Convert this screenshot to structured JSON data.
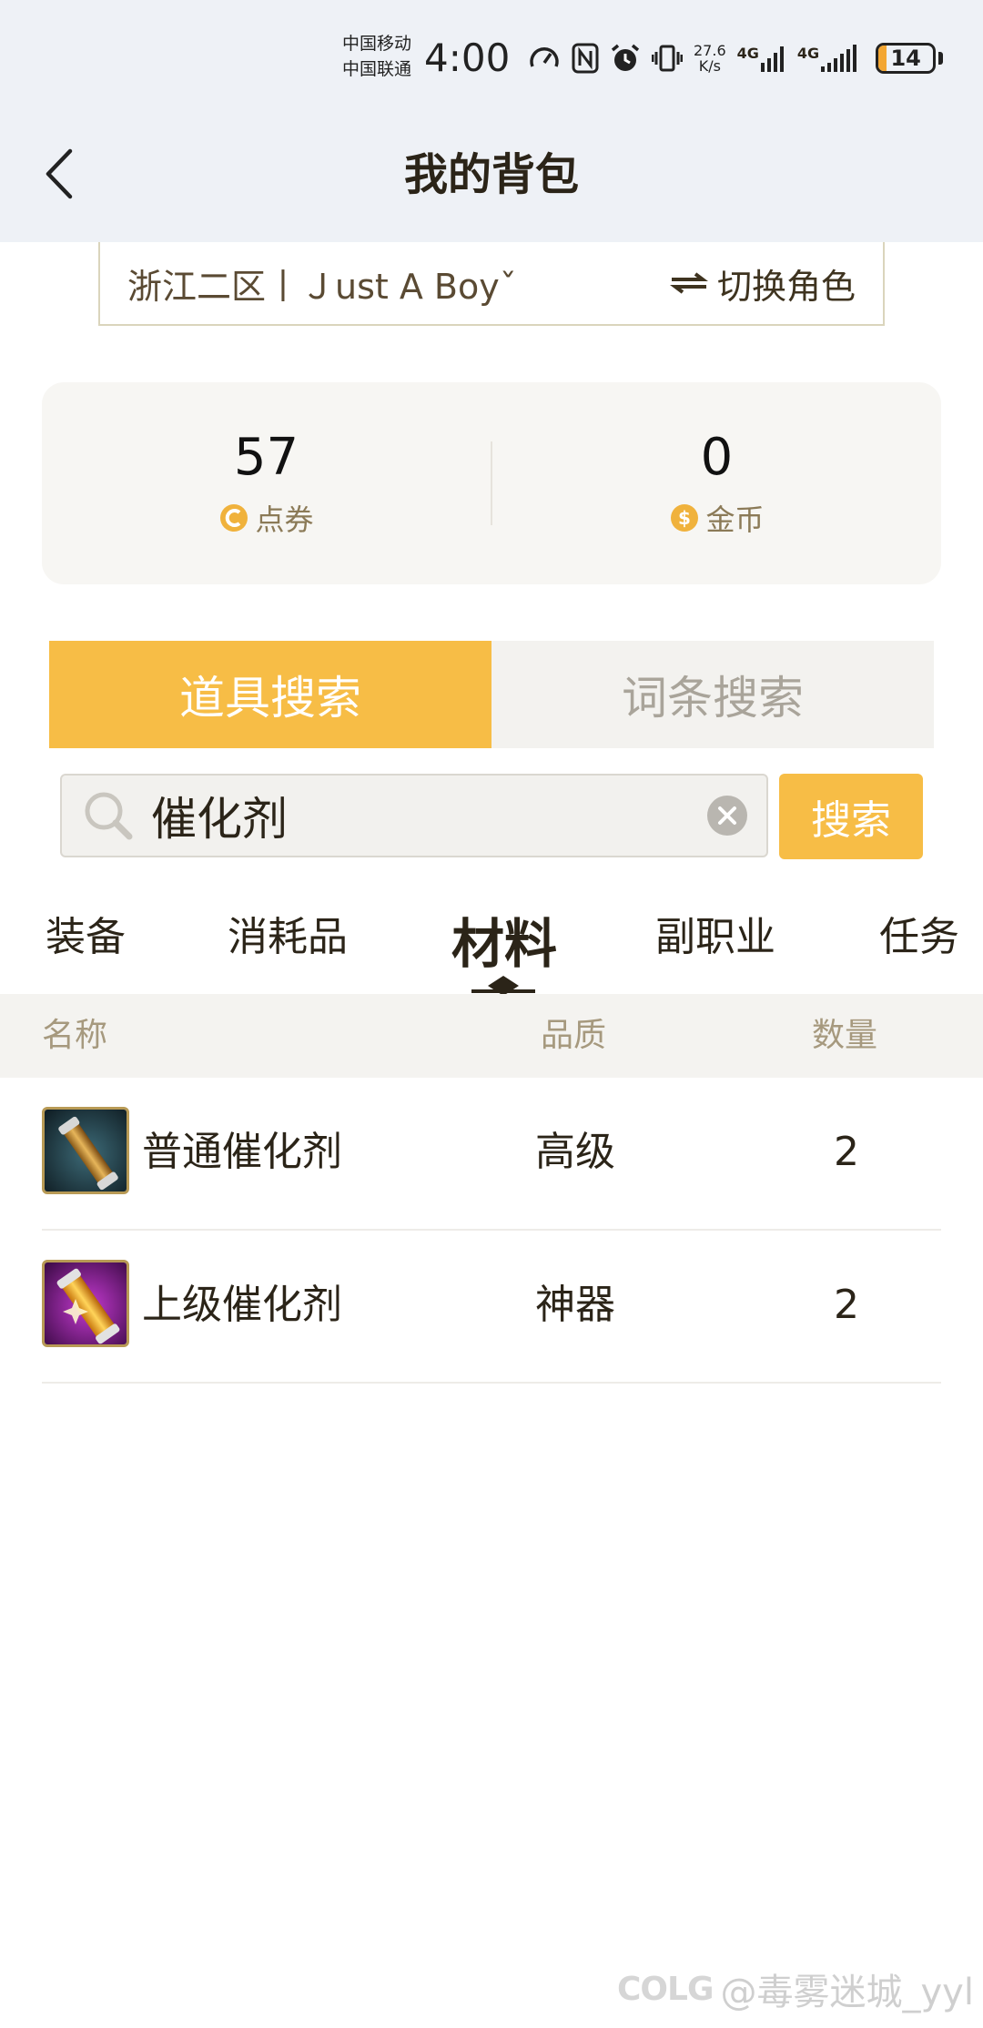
{
  "status_bar": {
    "carrier_1": "中国移动",
    "carrier_2": "中国联通",
    "time": "4:00",
    "net_speed_value": "27.6",
    "net_speed_unit": "K/s",
    "signal_1": "4G",
    "signal_2": "4G",
    "battery": "14",
    "battery_level": 0.14,
    "battery_color": "#f3a632"
  },
  "header": {
    "title": "我的背包",
    "back_icon": "chevron-left-icon"
  },
  "role": {
    "server_and_name": "浙江二区丨Ｊust A Boyˇ",
    "switch_label": "切换角色",
    "switch_icon": "swap-icon"
  },
  "currency": {
    "points": {
      "value": "57",
      "label": "点券",
      "icon": "coupon-icon"
    },
    "gold": {
      "value": "0",
      "label": "金币",
      "icon": "gold-coin-icon"
    }
  },
  "mode_tabs": [
    {
      "label": "道具搜索",
      "active": true
    },
    {
      "label": "词条搜索",
      "active": false
    }
  ],
  "search": {
    "value": "催化剂",
    "button_label": "搜索",
    "search_icon": "search-icon",
    "clear_icon": "clear-icon"
  },
  "categories": [
    {
      "label": "装备"
    },
    {
      "label": "消耗品"
    },
    {
      "label": "材料",
      "active": true
    },
    {
      "label": "副职业"
    },
    {
      "label": "任务"
    }
  ],
  "table": {
    "headers": {
      "name": "名称",
      "quality": "品质",
      "count": "数量"
    },
    "rows": [
      {
        "name": "普通催化剂",
        "quality": "高级",
        "count": "2",
        "icon": "catalyst-common-icon"
      },
      {
        "name": "上级催化剂",
        "quality": "神器",
        "count": "2",
        "icon": "catalyst-superior-icon"
      }
    ]
  },
  "watermark": {
    "logo": "COLG",
    "text": "@毒雾迷城_yyl"
  },
  "colors": {
    "accent": "#f7bd46",
    "text_dark": "#2b2418",
    "muted": "#a6997e"
  }
}
